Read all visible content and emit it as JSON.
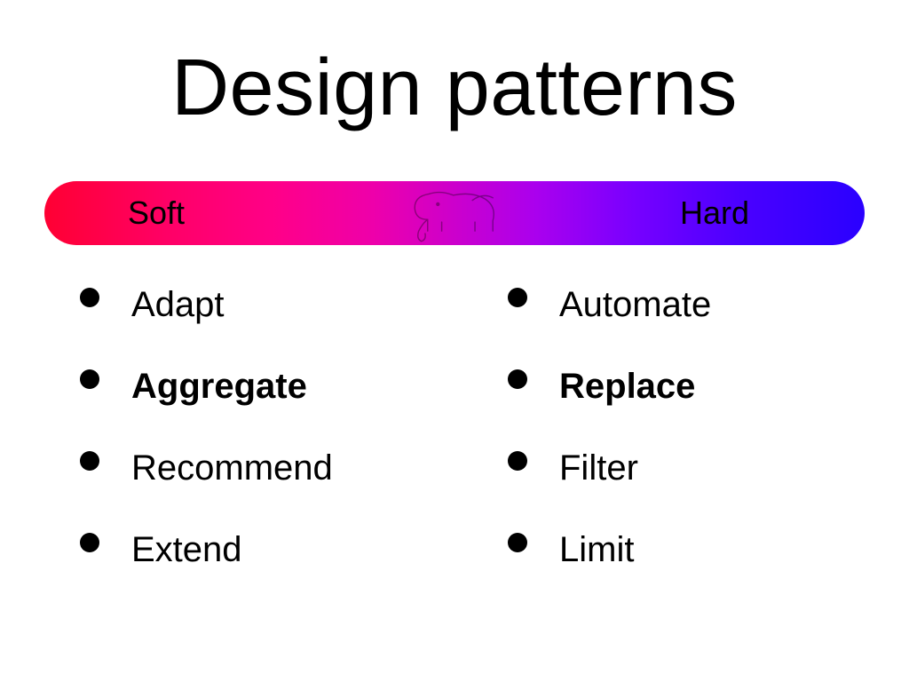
{
  "title": "Design patterns",
  "bar": {
    "left_label": "Soft",
    "right_label": "Hard"
  },
  "soft_items": [
    {
      "text": "Adapt",
      "bold": false
    },
    {
      "text": "Aggregate",
      "bold": true
    },
    {
      "text": "Recommend",
      "bold": false
    },
    {
      "text": "Extend",
      "bold": false
    }
  ],
  "hard_items": [
    {
      "text": "Automate",
      "bold": false
    },
    {
      "text": "Replace",
      "bold": true
    },
    {
      "text": "Filter",
      "bold": false
    },
    {
      "text": "Limit",
      "bold": false
    }
  ]
}
